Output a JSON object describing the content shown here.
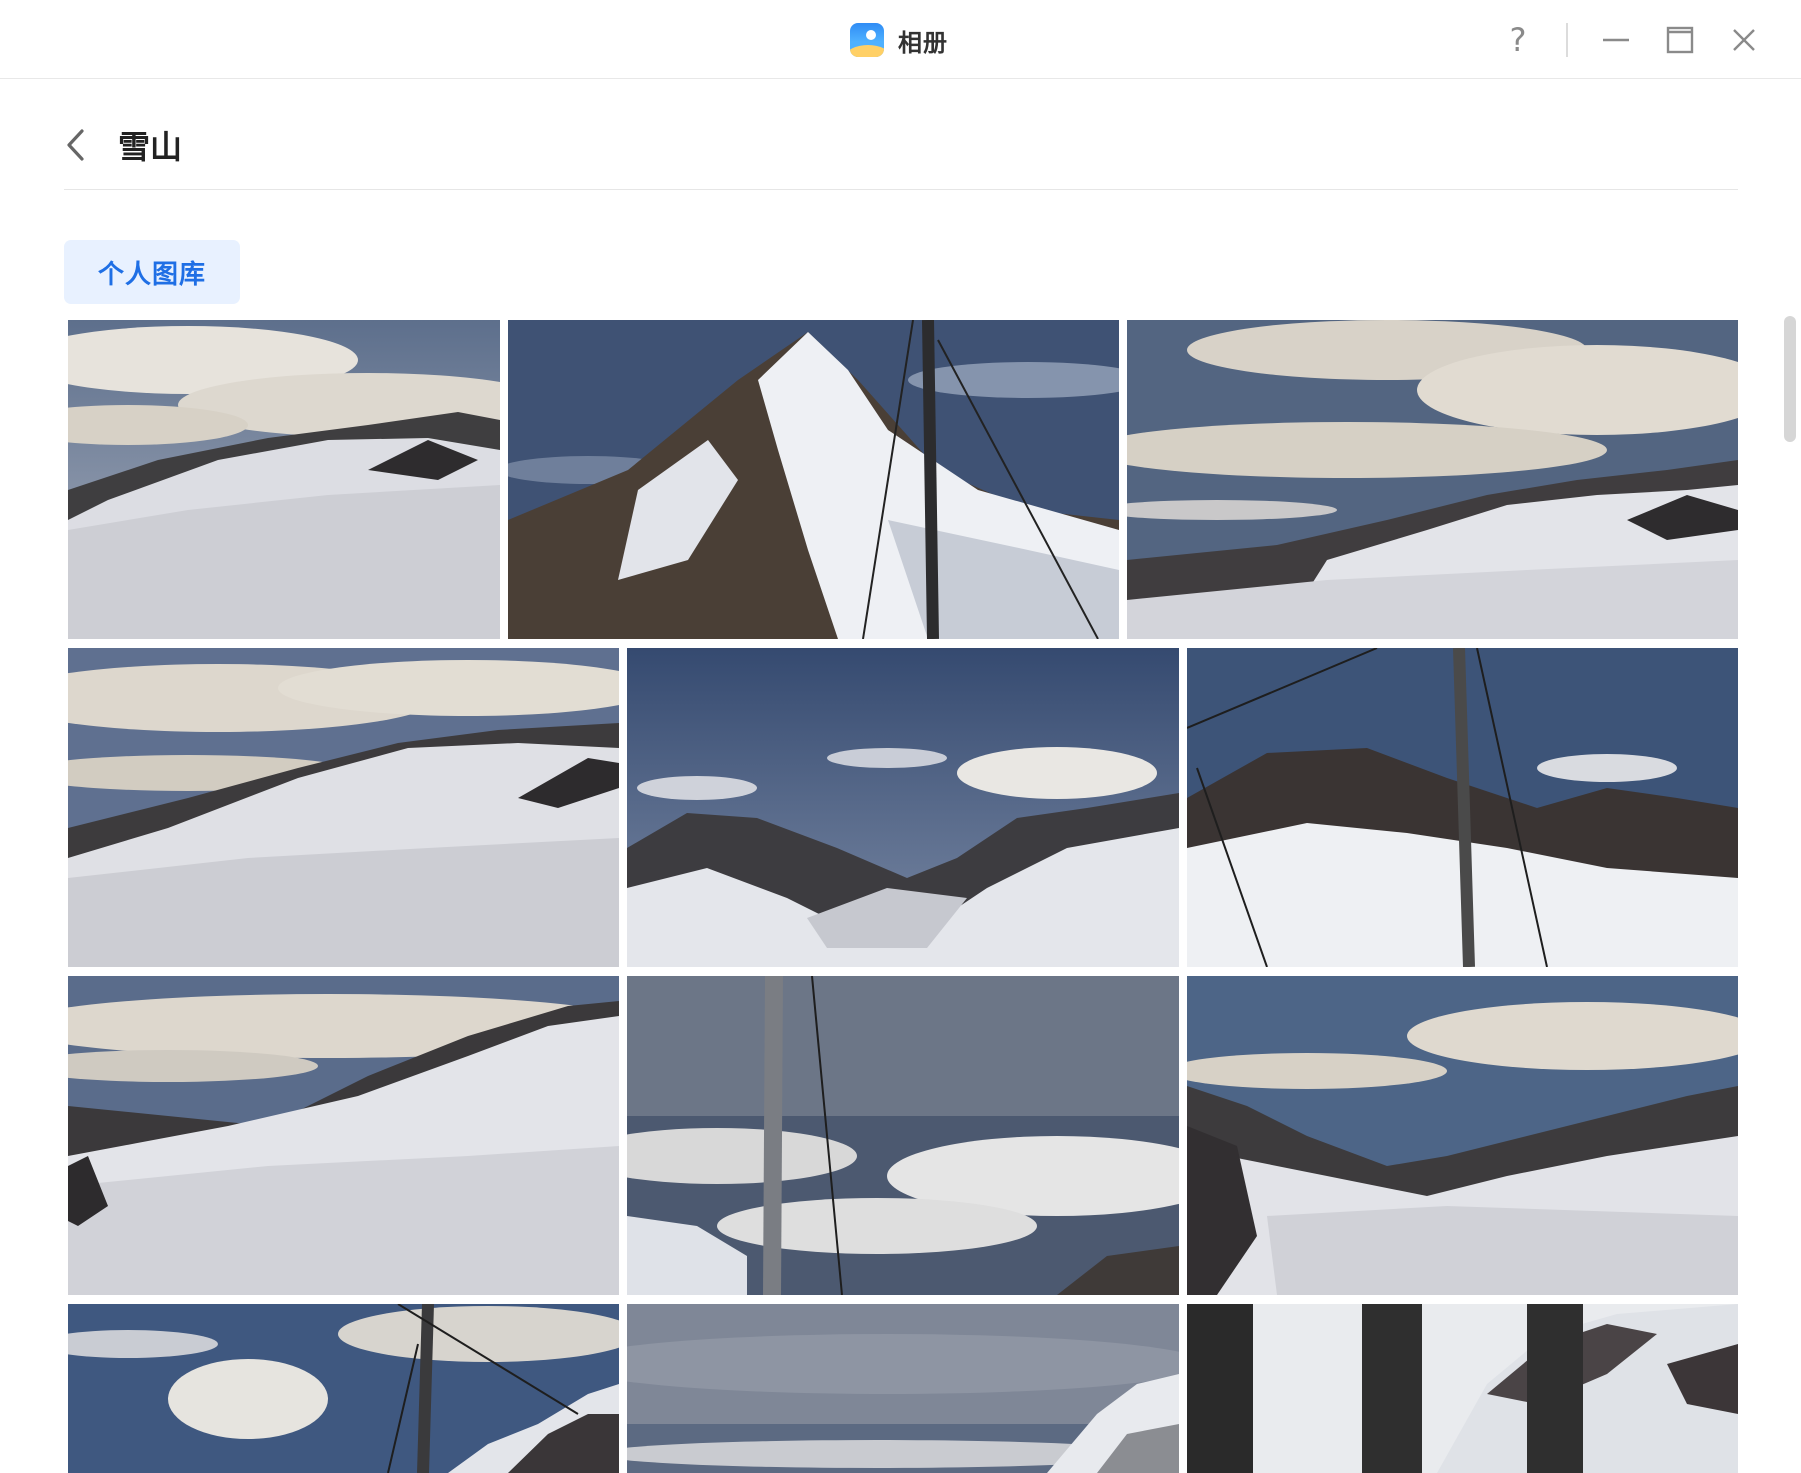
{
  "window": {
    "app_title": "相册",
    "app_icon": "photos-app-icon",
    "controls": {
      "help_label": "?",
      "help_icon": "help-icon",
      "minimize_icon": "minimize-icon",
      "maximize_icon": "maximize-icon",
      "close_icon": "close-icon"
    }
  },
  "header": {
    "back_icon": "chevron-left-icon",
    "title": "雪山"
  },
  "tabs": [
    {
      "label": "个人图库",
      "selected": true
    }
  ],
  "colors": {
    "accent": "#1f6fe5",
    "tab_bg": "#e8f1ff",
    "text_primary": "#222222",
    "divider": "#e6e6e6"
  },
  "photos": [
    {
      "scene": "glacier-clouds"
    },
    {
      "scene": "peak-pole"
    },
    {
      "scene": "wide-glacier-clouds"
    },
    {
      "scene": "glacier-slope"
    },
    {
      "scene": "valley-blue-sky"
    },
    {
      "scene": "ridge-pole"
    },
    {
      "scene": "glacier-valley"
    },
    {
      "scene": "sea-of-clouds-pole"
    },
    {
      "scene": "glacier-blue-sky"
    },
    {
      "scene": "clouds-pole-ridge"
    },
    {
      "scene": "grey-clouds-slope"
    },
    {
      "scene": "window-snow"
    }
  ]
}
